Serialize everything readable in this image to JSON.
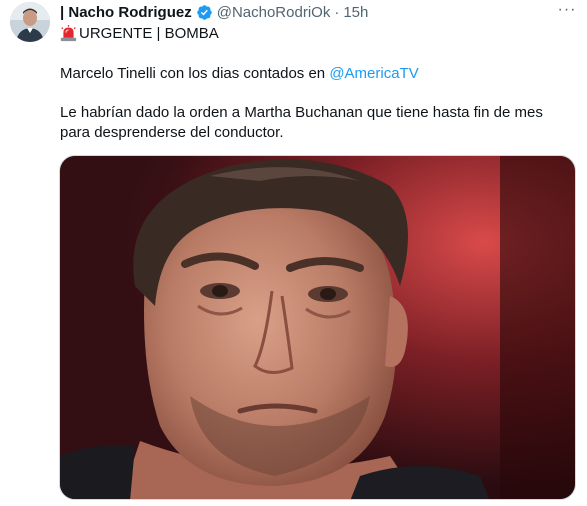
{
  "tweet": {
    "author": {
      "display_name": "| Nacho Rodriguez",
      "handle": "@NachoRodriOk",
      "separator": "·",
      "time": "15h",
      "verified": true,
      "avatar_icon": "user-avatar"
    },
    "more_icon": "more-horizontal-icon",
    "more_label": "···",
    "headline": {
      "emoji_icon": "siren-emoji-icon",
      "text": "URGENTE | BOMBA"
    },
    "paragraph1": {
      "text": "Marcelo Tinelli con los dias contados en ",
      "mention": "@AmericaTV"
    },
    "paragraph2": "Le habrían dado la orden a Martha Buchanan que tiene hasta fin de mes para desprenderse del conductor.",
    "media": {
      "type": "photo",
      "icon": "photo-media"
    }
  },
  "colors": {
    "text_primary": "#0f1419",
    "text_secondary": "#536471",
    "link": "#1d9bf0",
    "verified_badge": "#1d9bf0",
    "border": "#cfd9de"
  }
}
